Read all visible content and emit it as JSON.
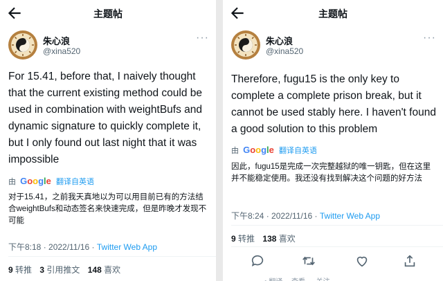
{
  "colors": {
    "link": "#1d9bf0",
    "muted": "#536471",
    "text": "#0f1419"
  },
  "left": {
    "header": {
      "title": "主题帖",
      "back_icon": "arrow-left-icon"
    },
    "author": {
      "name": "朱心浪",
      "handle": "@xina520",
      "menu": "···"
    },
    "tweet_text": "For 15.41, before that, I naively thought that the current existing method could be used in combination with weightBufs and dynamic signature to quickly complete it, but I only found out last night that it was impossible",
    "translation": {
      "by": "由",
      "google": "Google",
      "label": "翻译自英语"
    },
    "translated_text": "对于15.41，之前我天真地以为可以用目前已有的方法结合weightBufs和动态签名来快速完成，但是昨晚才发现不可能",
    "meta": {
      "time": "下午8:18 · 2022/11/16 · ",
      "source": "Twitter Web App"
    },
    "stats": {
      "retweets": "9",
      "retweets_label": "转推",
      "quotes": "3",
      "quotes_label": "引用推文",
      "likes": "148",
      "likes_label": "喜欢"
    }
  },
  "right": {
    "header": {
      "title": "主题帖",
      "back_icon": "arrow-left-icon"
    },
    "author": {
      "name": "朱心浪",
      "handle": "@xina520",
      "menu": "···"
    },
    "tweet_text": "Therefore, fugu15 is the only key to complete a complete prison break, but it cannot be used stably here. I haven't found a good solution to this problem",
    "translation": {
      "by": "由",
      "google": "Google",
      "label": "翻译自英语"
    },
    "translated_text": "因此，fugu15是完成一次完整越狱的唯一钥匙，但在这里并不能稳定使用。我还没有找到解决这个问题的好方法",
    "meta": {
      "time": "下午8:24 · 2022/11/16 · ",
      "source": "Twitter Web App"
    },
    "stats": {
      "retweets": "9",
      "retweets_label": "转推",
      "likes": "138",
      "likes_label": "喜欢"
    },
    "actions": [
      "reply-icon",
      "retweet-icon",
      "like-icon",
      "share-icon"
    ],
    "cutoff_text": "• 翻译… 查看 … 关注 …"
  }
}
